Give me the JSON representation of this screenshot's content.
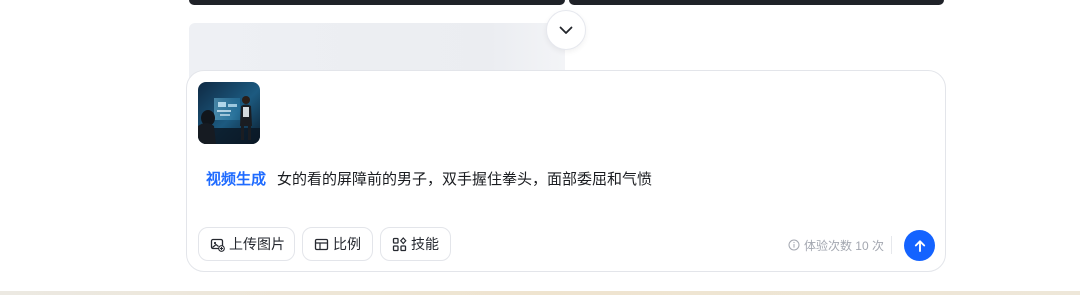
{
  "scroll_control": {
    "icon": "chevron-down-icon"
  },
  "composer": {
    "attachment": {
      "icon": "image-thumbnail",
      "description": ""
    },
    "mode_tag": "视频生成",
    "prompt": "女的看的屏障前的男子，双手握住拳头，面部委屈和气愤",
    "toolbar": {
      "upload_label": "上传图片",
      "ratio_label": "比例",
      "skill_label": "技能"
    },
    "quota_text": "体验次数 10 次",
    "send_icon": "arrow-up-icon"
  },
  "colors": {
    "accent": "#1463ff",
    "mode_tag": "#1f6bff",
    "muted_text": "#a3a7b0"
  }
}
